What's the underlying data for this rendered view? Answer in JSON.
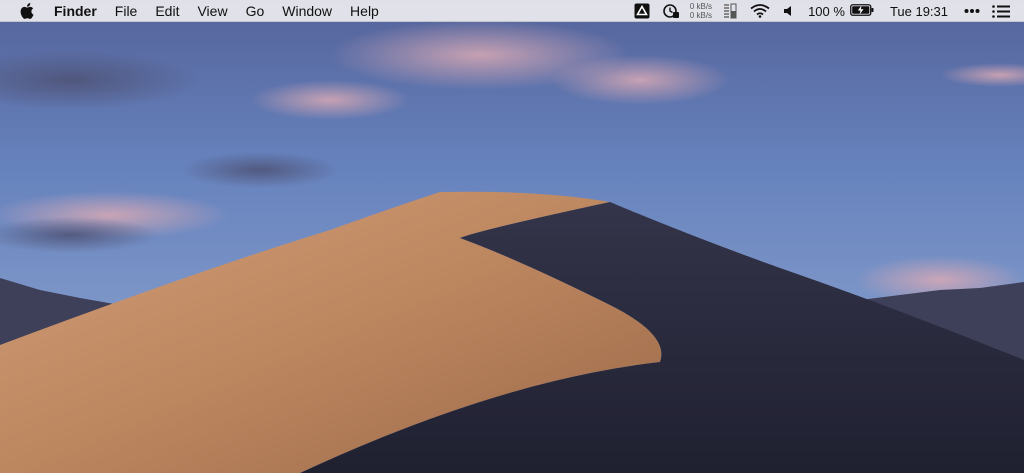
{
  "menubar": {
    "app_name": "Finder",
    "menus": [
      "File",
      "Edit",
      "View",
      "Go",
      "Window",
      "Help"
    ],
    "status": {
      "net_up": "0 kB/s",
      "net_down": "0 kB/s",
      "battery_percent": "100 %",
      "clock": "Tue 19:31"
    },
    "icons": {
      "apple": "apple-logo",
      "drive": "google-drive-icon",
      "sync": "time-machine-icon",
      "memory": "memory-meter-icon",
      "wifi": "wifi-icon",
      "volume": "volume-icon",
      "battery": "battery-charging-icon",
      "more": "more-dots-icon",
      "notifications": "notification-center-icon"
    }
  },
  "colors": {
    "menubar_bg": "#ECECF0",
    "sky_top": "#5D6EA6",
    "dune_light": "#C08A63",
    "dune_dark": "#2A2B3E"
  }
}
